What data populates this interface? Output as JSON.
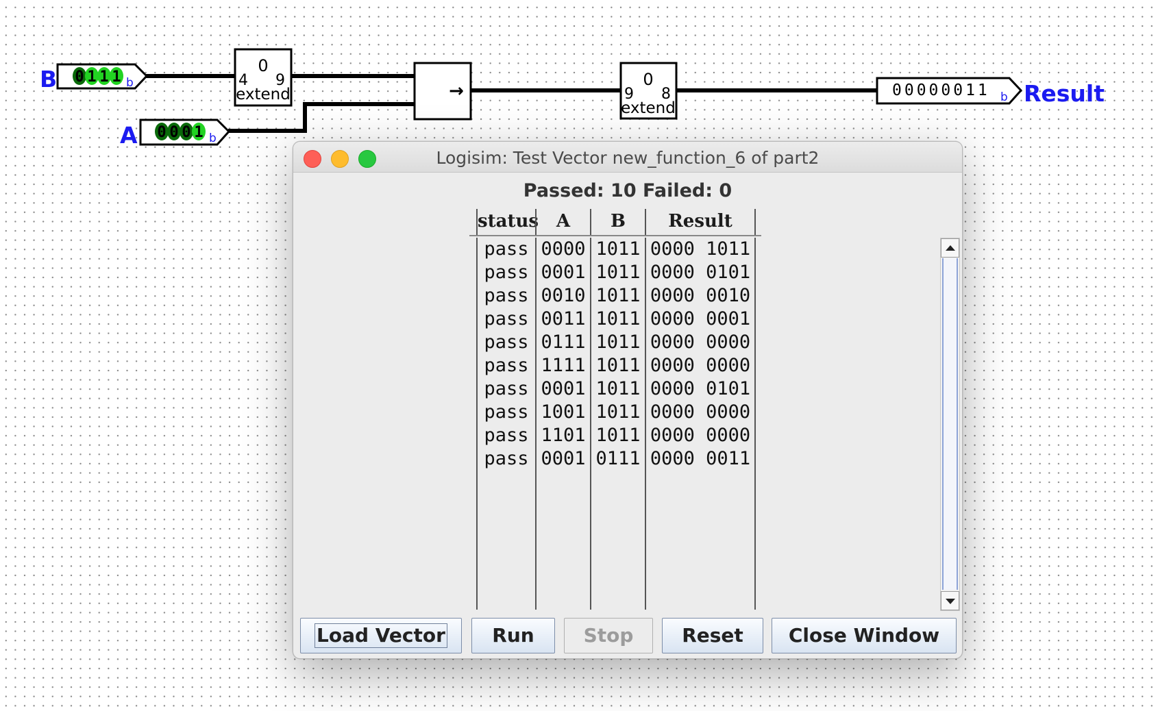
{
  "canvas": {
    "pin_b": {
      "label": "B",
      "value": "0111",
      "radix": "b"
    },
    "pin_a": {
      "label": "A",
      "value": "0001",
      "radix": "b"
    },
    "extender_1": {
      "top": "0",
      "in_width": "4",
      "out_width": "9",
      "name": "extend"
    },
    "shifter": {
      "symbol": "→"
    },
    "extender_2": {
      "top": "0",
      "in_width": "9",
      "out_width": "8",
      "name": "extend"
    },
    "result": {
      "label": "Result",
      "value": "00000011",
      "radix": "b"
    }
  },
  "dialog": {
    "title": "Logisim: Test Vector new_function_6 of part2",
    "summary": "Passed: 10 Failed: 0",
    "columns": [
      "status",
      "A",
      "B",
      "Result"
    ],
    "rows": [
      {
        "status": "pass",
        "A": "0000",
        "B": "1011",
        "Result": "0000 1011"
      },
      {
        "status": "pass",
        "A": "0001",
        "B": "1011",
        "Result": "0000 0101"
      },
      {
        "status": "pass",
        "A": "0010",
        "B": "1011",
        "Result": "0000 0010"
      },
      {
        "status": "pass",
        "A": "0011",
        "B": "1011",
        "Result": "0000 0001"
      },
      {
        "status": "pass",
        "A": "0111",
        "B": "1011",
        "Result": "0000 0000"
      },
      {
        "status": "pass",
        "A": "1111",
        "B": "1011",
        "Result": "0000 0000"
      },
      {
        "status": "pass",
        "A": "0001",
        "B": "1011",
        "Result": "0000 0101"
      },
      {
        "status": "pass",
        "A": "1001",
        "B": "1011",
        "Result": "0000 0000"
      },
      {
        "status": "pass",
        "A": "1101",
        "B": "1011",
        "Result": "0000 0000"
      },
      {
        "status": "pass",
        "A": "0001",
        "B": "0111",
        "Result": "0000 0011"
      }
    ],
    "buttons": {
      "load": "Load Vector",
      "run": "Run",
      "stop": "Stop",
      "reset": "Reset",
      "close": "Close Window"
    }
  },
  "colors": {
    "pin_label": "#1b1bf0",
    "bit_one": "#22d322",
    "bit_zero": "#0a6a0a",
    "wire": "#000000"
  }
}
